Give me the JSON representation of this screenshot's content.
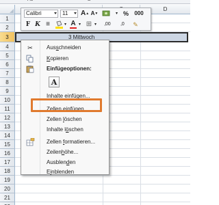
{
  "columns": [
    "A5",
    "B",
    "C",
    "D"
  ],
  "top_strip_cells": [
    "A5",
    "B"
  ],
  "rows": [
    "1",
    "2",
    "3",
    "4",
    "5",
    "6",
    "7",
    "8",
    "9",
    "10",
    "11",
    "12",
    "13",
    "14",
    "15",
    "16",
    "17",
    "18",
    "19",
    "20",
    "21",
    "22"
  ],
  "selected_row": "3",
  "selected_cell_value": "3 Mittwoch",
  "mini_toolbar": {
    "font_name": "Calibri",
    "font_size": "11",
    "grow_font": "A",
    "shrink_font": "A",
    "currency": "%",
    "thousands": "000",
    "bold": "F",
    "italic": "K",
    "center": "≡",
    "fill_color": "▲",
    "font_color": "A",
    "borders": "⊞",
    "increase_decimal": "‚00",
    "decrease_decimal": "‚0",
    "format_painter": "✎"
  },
  "accent_colors": {
    "selection": "#ccd6e4",
    "highlight_border": "#e07a2e",
    "fill_yellow": "#ffe000",
    "font_red": "#e02020"
  },
  "context_menu": {
    "cut": {
      "icon": "scissors-icon",
      "pre": "Aus",
      "key": "s",
      "post": "chneiden"
    },
    "copy": {
      "icon": "copy-icon",
      "pre": "",
      "key": "K",
      "post": "opieren"
    },
    "paste_options_title": "Einfügeoptionen:",
    "paste_option": "A",
    "paste_special": {
      "pre": "Inhalte ",
      "key": "e",
      "post": "infügen..."
    },
    "insert_cells": {
      "pre": "Zellen ",
      "key": "e",
      "post": "infügen"
    },
    "delete_cells": {
      "pre": "Zellen ",
      "key": "l",
      "post": "öschen"
    },
    "clear_contents": {
      "pre": "Inhalte l",
      "key": "ö",
      "post": "schen"
    },
    "format_cells": {
      "icon": "format-cells-icon",
      "pre": "Zellen ",
      "key": "f",
      "post": "ormatieren..."
    },
    "row_height": {
      "pre": "Zeilen",
      "key": "h",
      "post": "öhe..."
    },
    "hide": {
      "pre": "Ausblen",
      "key": "d",
      "post": "en"
    },
    "unhide": {
      "pre": "E",
      "key": "i",
      "post": "nblenden"
    }
  }
}
